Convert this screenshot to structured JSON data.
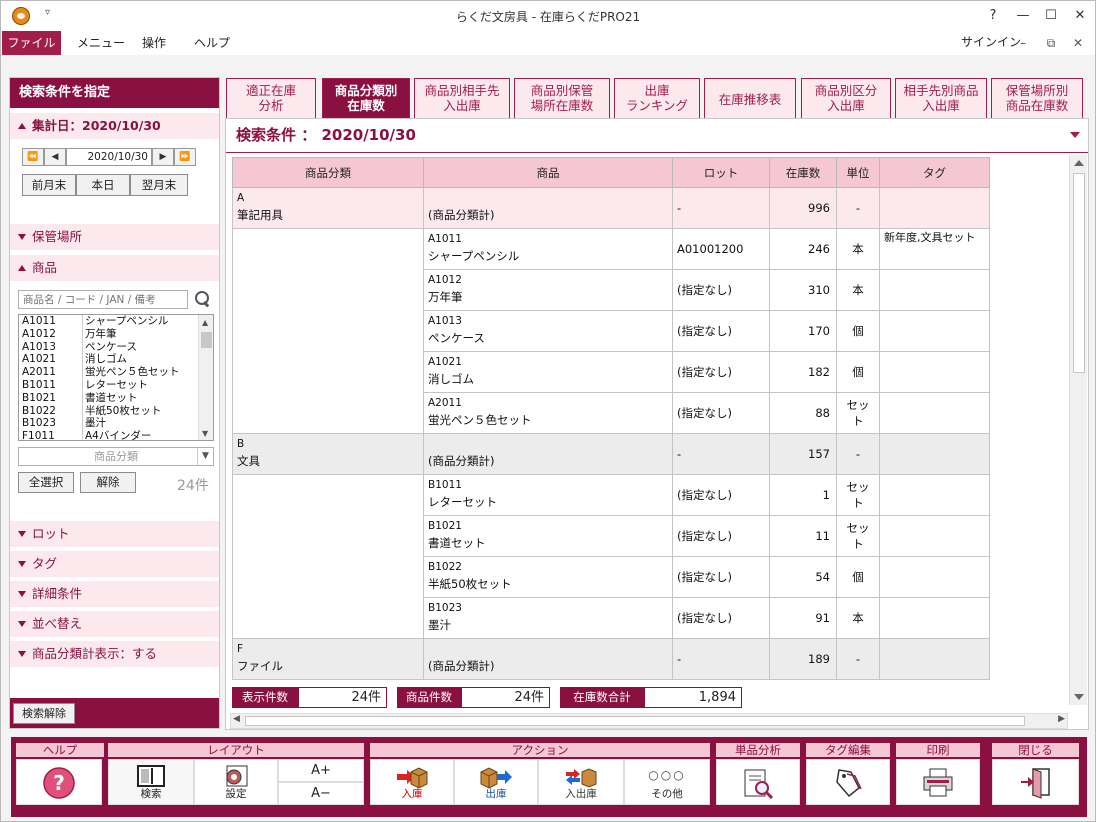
{
  "window": {
    "title": "らくだ文房具 - 在庫らくだPRO21",
    "qa": "▿",
    "help": "?",
    "min": "—",
    "max": "☐",
    "close": "✕"
  },
  "menubar": {
    "file": "ファイル",
    "items": [
      "メニュー",
      "操作",
      "ヘルプ"
    ],
    "signin": "サインイン",
    "min": "–",
    "restore": "⧉",
    "close": "✕"
  },
  "sidebar": {
    "header": "検索条件を指定",
    "date_section": "集計日：2020/10/30",
    "date_value": "2020/10/30",
    "nav": [
      "⏪",
      "◀",
      "▶",
      "⏩"
    ],
    "date_buttons": [
      "前月末",
      "本日",
      "翌月末"
    ],
    "sections": {
      "storage": "保管場所",
      "product": "商品",
      "lot": "ロット",
      "tag": "タグ",
      "detail": "詳細条件",
      "sort": "並べ替え",
      "subtotal": "商品分類計表示：する"
    },
    "search_placeholder": "商品名 / コード / JAN / 備考",
    "products": [
      {
        "code": "A1011",
        "name": "シャープペンシル"
      },
      {
        "code": "A1012",
        "name": "万年筆"
      },
      {
        "code": "A1013",
        "name": "ペンケース"
      },
      {
        "code": "A1021",
        "name": "消しゴム"
      },
      {
        "code": "A2011",
        "name": "蛍光ペン５色セット"
      },
      {
        "code": "B1011",
        "name": "レターセット"
      },
      {
        "code": "B1021",
        "name": "書道セット"
      },
      {
        "code": "B1022",
        "name": "半紙50枚セット"
      },
      {
        "code": "B1023",
        "name": "墨汁"
      },
      {
        "code": "F1011",
        "name": "A4バインダー"
      }
    ],
    "category_select": "商品分類",
    "select_all": "全選択",
    "clear": "解除",
    "count": "24件",
    "search_clear": "検索解除"
  },
  "tabs": [
    {
      "l1": "適正在庫",
      "l2": "分析"
    },
    {
      "l1": "商品分類別",
      "l2": "在庫数"
    },
    {
      "l1": "商品別相手先",
      "l2": "入出庫"
    },
    {
      "l1": "商品別保管",
      "l2": "場所在庫数"
    },
    {
      "l1": "出庫",
      "l2": "ランキング"
    },
    {
      "l1": "在庫推移表",
      "l2": ""
    },
    {
      "l1": "商品別区分",
      "l2": "入出庫"
    },
    {
      "l1": "相手先別商品",
      "l2": "入出庫"
    },
    {
      "l1": "保管場所別",
      "l2": "商品在庫数"
    }
  ],
  "condition": "検索条件 ： 2020/10/30",
  "table": {
    "headers": [
      "商品分類",
      "商品",
      "ロット",
      "在庫数",
      "単位",
      "タグ"
    ],
    "subtotal_label": "(商品分類計)",
    "groups": [
      {
        "code": "A",
        "name": "筆記用具",
        "sum": {
          "lot": "-",
          "qty": "996",
          "unit": "-"
        },
        "rows": [
          {
            "code": "A1011",
            "name": "シャープペンシル",
            "lot": "A01001200",
            "qty": "246",
            "unit": "本",
            "tag": "新年度,文具セット"
          },
          {
            "code": "A1012",
            "name": "万年筆",
            "lot": "(指定なし)",
            "qty": "310",
            "unit": "本",
            "tag": ""
          },
          {
            "code": "A1013",
            "name": "ペンケース",
            "lot": "(指定なし)",
            "qty": "170",
            "unit": "個",
            "tag": ""
          },
          {
            "code": "A1021",
            "name": "消しゴム",
            "lot": "(指定なし)",
            "qty": "182",
            "unit": "個",
            "tag": ""
          },
          {
            "code": "A2011",
            "name": "蛍光ペン５色セット",
            "lot": "(指定なし)",
            "qty": "88",
            "unit": "セット",
            "tag": ""
          }
        ]
      },
      {
        "code": "B",
        "name": "文具",
        "sum": {
          "lot": "-",
          "qty": "157",
          "unit": "-"
        },
        "rows": [
          {
            "code": "B1011",
            "name": "レターセット",
            "lot": "(指定なし)",
            "qty": "1",
            "unit": "セット",
            "tag": ""
          },
          {
            "code": "B1021",
            "name": "書道セット",
            "lot": "(指定なし)",
            "qty": "11",
            "unit": "セット",
            "tag": ""
          },
          {
            "code": "B1022",
            "name": "半紙50枚セット",
            "lot": "(指定なし)",
            "qty": "54",
            "unit": "個",
            "tag": ""
          },
          {
            "code": "B1023",
            "name": "墨汁",
            "lot": "(指定なし)",
            "qty": "91",
            "unit": "本",
            "tag": ""
          }
        ]
      },
      {
        "code": "F",
        "name": "ファイル",
        "sum": {
          "lot": "-",
          "qty": "189",
          "unit": "-"
        },
        "rows": []
      }
    ]
  },
  "summary": {
    "display_label": "表示件数",
    "display_value": "24件",
    "product_label": "商品件数",
    "product_value": "24件",
    "stock_label": "在庫数合計",
    "stock_value": "1,894"
  },
  "toolbar": {
    "groups": {
      "help": "ヘルプ",
      "layout": "レイアウト",
      "action": "アクション",
      "single": "単品分析",
      "tag": "タグ編集",
      "print": "印刷",
      "close": "閉じる"
    },
    "buttons": {
      "search": "検索",
      "settings": "設定",
      "font_up": "A+",
      "font_down": "A−",
      "in": "入庫",
      "out": "出庫",
      "inout": "入出庫",
      "other": "その他",
      "other_dots": "○○○"
    }
  },
  "colors": {
    "accent": "#8b1042",
    "accent_light": "#fbe9ee",
    "header": "#f4c7d3"
  }
}
